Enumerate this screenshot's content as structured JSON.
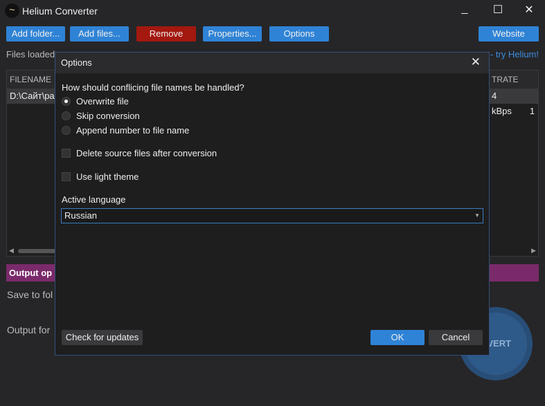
{
  "window": {
    "title": "Helium Converter",
    "minimize": "_",
    "maximize": "☐",
    "close": "✕"
  },
  "toolbar": {
    "add_folder": "Add folder...",
    "add_files": "Add files...",
    "remove": "Remove",
    "properties": "Properties...",
    "options": "Options",
    "website": "Website"
  },
  "status": {
    "files_loaded": "Files loaded",
    "try": "- try Helium!"
  },
  "table": {
    "col_filename": "FILENAME",
    "col_bitrate": "TRATE",
    "row_filename": "D:\\Сайт\\ра",
    "row_bitrate": "4 kBps",
    "row_extra": "1"
  },
  "output": {
    "header": "Output op",
    "save_to": "Save to fol",
    "format": "Output for",
    "convert": "NVERT"
  },
  "dialog": {
    "title": "Options",
    "close": "✕",
    "question": "How should conflicing file names be handled?",
    "radios": [
      {
        "label": "Overwrite file",
        "checked": true
      },
      {
        "label": "Skip conversion",
        "checked": false
      },
      {
        "label": "Append number to file name",
        "checked": false
      }
    ],
    "delete_source": "Delete source files after conversion",
    "light_theme": "Use light theme",
    "language_label": "Active language",
    "language_value": "Russian",
    "check_updates": "Check for updates",
    "ok": "OK",
    "cancel": "Cancel"
  },
  "colors": {
    "accent": "#2f83d6",
    "remove": "#a3180f",
    "output_bar": "#7a2a6a"
  }
}
